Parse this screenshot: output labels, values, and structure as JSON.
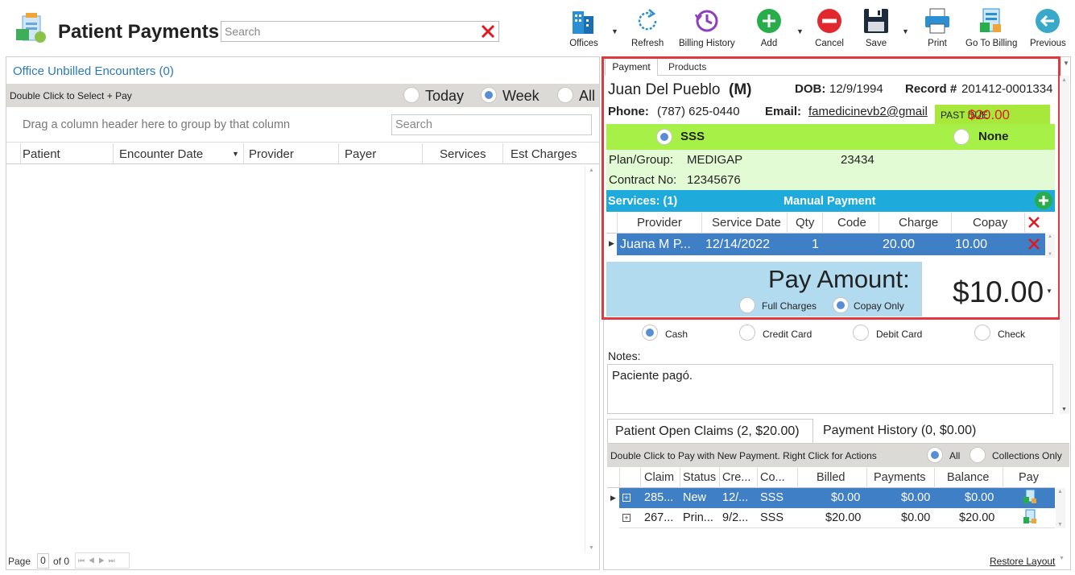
{
  "header": {
    "title": "Patient Payments",
    "search_placeholder": "Search"
  },
  "toolbar": {
    "offices": "Offices",
    "refresh": "Refresh",
    "billing_history": "Billing History",
    "add": "Add",
    "cancel": "Cancel",
    "save": "Save",
    "print": "Print",
    "go_to_billing": "Go To Billing",
    "previous": "Previous"
  },
  "left": {
    "title": "Office Unbilled Encounters (0)",
    "instruction": "Double Click to Select + Pay",
    "range_options": [
      "Today",
      "Week",
      "All"
    ],
    "range_selected": "Week",
    "group_hint": "Drag a column header here to group by that column",
    "search_placeholder": "Search",
    "columns": [
      "Patient",
      "Encounter Date",
      "Provider",
      "Payer",
      "Services",
      "Est Charges"
    ],
    "pager": {
      "page_label": "Page",
      "page": "0",
      "of_label": "of 0"
    }
  },
  "right": {
    "tabs": [
      "Payment",
      "Products"
    ],
    "patient": {
      "name": "Juan Del Pueblo",
      "gender": "(M)",
      "dob_label": "DOB:",
      "dob": "12/9/1994",
      "record_label": "Record #",
      "record": "201412-0001334",
      "phone_label": "Phone:",
      "phone": "(787) 625-0440",
      "email_label": "Email:",
      "email": "famedicinevb2@gmail",
      "past_due_label": "PAST DUE",
      "past_due": "$20.00"
    },
    "insurance": {
      "options": [
        "SSS",
        "None"
      ],
      "selected": "SSS",
      "plan_label": "Plan/Group:",
      "plan": "MEDIGAP",
      "group": "23434",
      "contract_label": "Contract No:",
      "contract": "12345676"
    },
    "services": {
      "title": "Services: (1)",
      "manual": "Manual Payment",
      "columns": [
        "Provider",
        "Service Date",
        "Qty",
        "Code",
        "Charge",
        "Copay"
      ],
      "rows": [
        {
          "provider": "Juana M P...",
          "date": "12/14/2022",
          "qty": "1",
          "code": "",
          "charge": "20.00",
          "copay": "10.00"
        }
      ]
    },
    "pay": {
      "label": "Pay Amount:",
      "amount": "$10.00",
      "options": [
        "Full Charges",
        "Copay Only"
      ],
      "selected": "Copay Only"
    },
    "methods": {
      "options": [
        "Cash",
        "Credit Card",
        "Debit Card",
        "Check"
      ],
      "selected": "Cash"
    },
    "notes": {
      "label": "Notes:",
      "value": "Paciente pagó."
    },
    "claims": {
      "tabs": [
        "Patient Open Claims (2, $20.00)",
        "Payment History (0, $0.00)"
      ],
      "instruction": "Double Click to Pay with New Payment. Right Click for Actions",
      "filter_options": [
        "All",
        "Collections Only"
      ],
      "filter_selected": "All",
      "columns": [
        "Claim",
        "Status",
        "Cre...",
        "Co...",
        "Billed",
        "Payments",
        "Balance",
        "Pay"
      ],
      "rows": [
        {
          "claim": "285...",
          "status": "New",
          "created": "12/...",
          "company": "SSS",
          "billed": "$0.00",
          "payments": "$0.00",
          "balance": "$0.00"
        },
        {
          "claim": "267...",
          "status": "Prin...",
          "created": "9/2...",
          "company": "SSS",
          "billed": "$20.00",
          "payments": "$0.00",
          "balance": "$20.00"
        }
      ]
    },
    "restore_layout": "Restore Layout"
  },
  "colors": {
    "accent_blue": "#3f7fc6",
    "link_blue": "#2a7ab8",
    "services_bar": "#1faadc",
    "insurance_green": "#a7f048",
    "past_due_red": "#e0191f",
    "highlight_box": "#e0393e"
  }
}
